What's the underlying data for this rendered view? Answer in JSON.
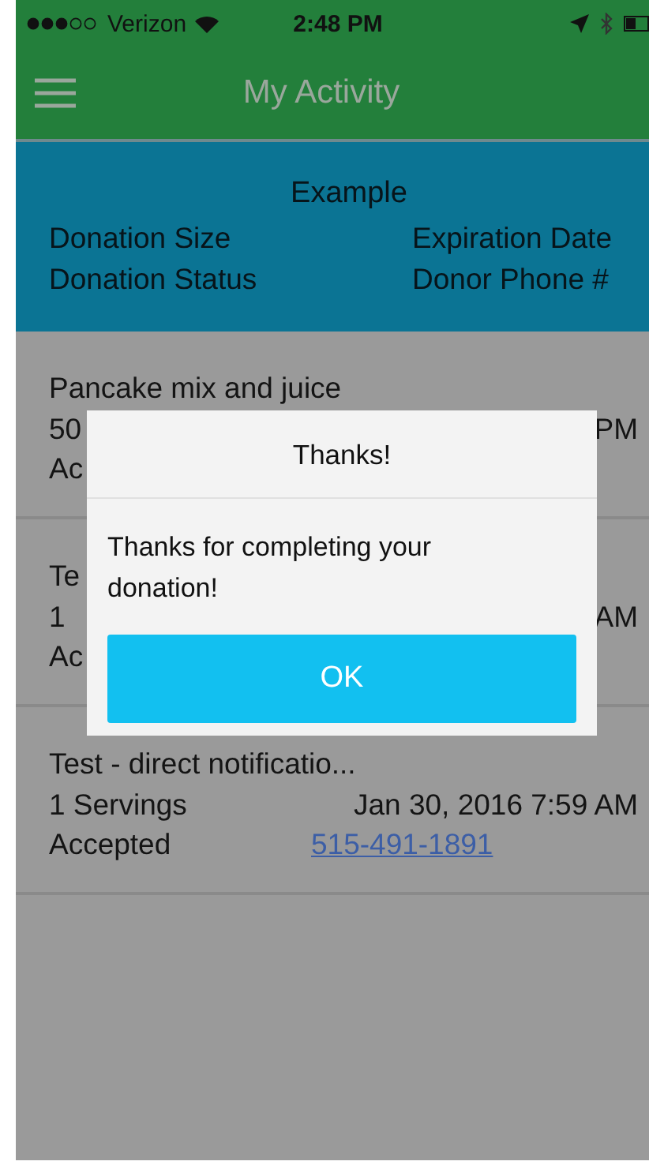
{
  "status_bar": {
    "carrier": "Verizon",
    "time": "2:48 PM"
  },
  "header": {
    "title": "My Activity"
  },
  "column_header": {
    "title": "Example",
    "labels": [
      "Donation Size",
      "Expiration Date",
      "Donation Status",
      "Donor Phone #"
    ]
  },
  "donations": [
    {
      "name": "Pancake mix and juice",
      "size": "50",
      "expiration": "PM",
      "status": "Ac"
    },
    {
      "name": "Te",
      "size": "1",
      "expiration": "AM",
      "status": "Ac"
    },
    {
      "name": "Test - direct notificatio...",
      "size": "1 Servings",
      "expiration": "Jan 30, 2016 7:59 AM",
      "status": "Accepted",
      "phone": "515-491-1891"
    }
  ],
  "dialog": {
    "title": "Thanks!",
    "message": "Thanks for completing your donation!",
    "button": "OK"
  }
}
